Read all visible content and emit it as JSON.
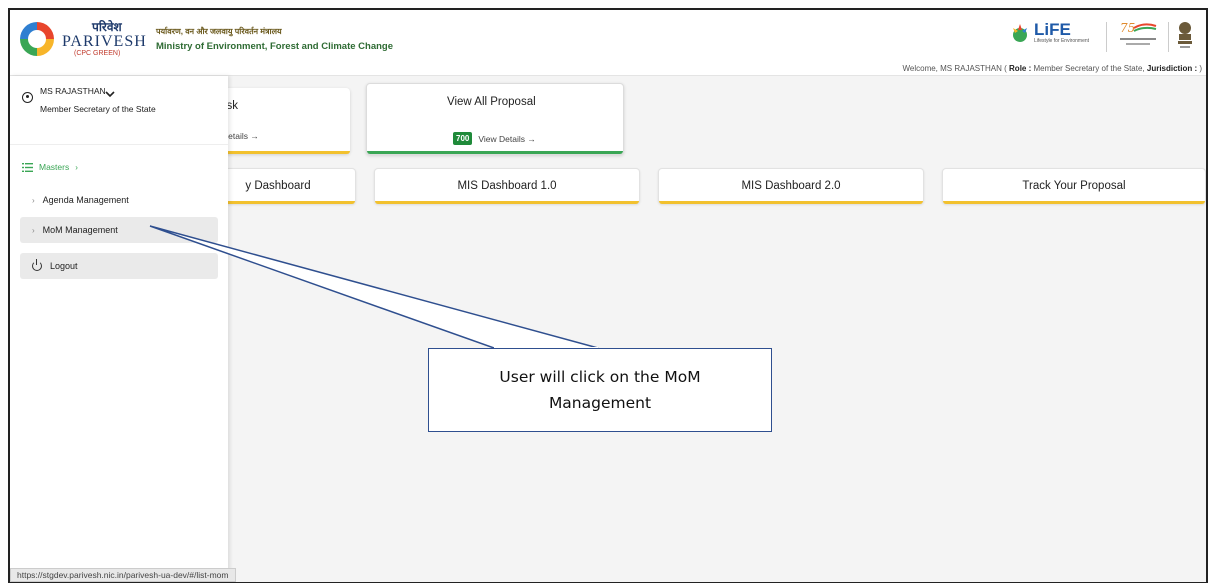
{
  "header": {
    "brand_hindi": "परिवेश",
    "brand_name": "PARIVESH",
    "brand_sub": "(CPC GREEN)",
    "ministry_hindi": "पर्यावरण, वन और जलवायु परिवर्तन मंत्रालय",
    "ministry_en": "Ministry of Environment, Forest and Climate Change",
    "life_text": "LiFE",
    "life_sub": "Lifestyle for Environment",
    "welcome_prefix": "Welcome, MS RAJASTHAN ( ",
    "role_label": "Role :",
    "role_value": " Member Secretary of the State, ",
    "jurisdiction_label": "Jurisdiction :",
    "welcome_suffix": " )"
  },
  "sidebar": {
    "user_name": "MS RAJASTHAN",
    "user_role": "Member Secretary of the State",
    "masters_label": "Masters",
    "items": [
      {
        "label": "Agenda Management"
      },
      {
        "label": "MoM Management"
      }
    ],
    "logout_label": "Logout"
  },
  "main": {
    "task_card_title": "isk",
    "task_card_detail": "Details →",
    "proposal_card_title": "View All Proposal",
    "proposal_count": "700",
    "proposal_detail": "View Details →",
    "dashboards": [
      {
        "label": "y Dashboard"
      },
      {
        "label": "MIS Dashboard 1.0"
      },
      {
        "label": "MIS Dashboard 2.0"
      },
      {
        "label": "Track Your Proposal"
      }
    ]
  },
  "status_url": "https://stgdev.parivesh.nic.in/parivesh-ua-dev/#/list-mom",
  "callout": {
    "text": "User will click on the MoM Management"
  },
  "colors": {
    "accent_green": "#3aa655",
    "accent_yellow": "#f2c12e",
    "callout_border": "#2f4f8f"
  }
}
